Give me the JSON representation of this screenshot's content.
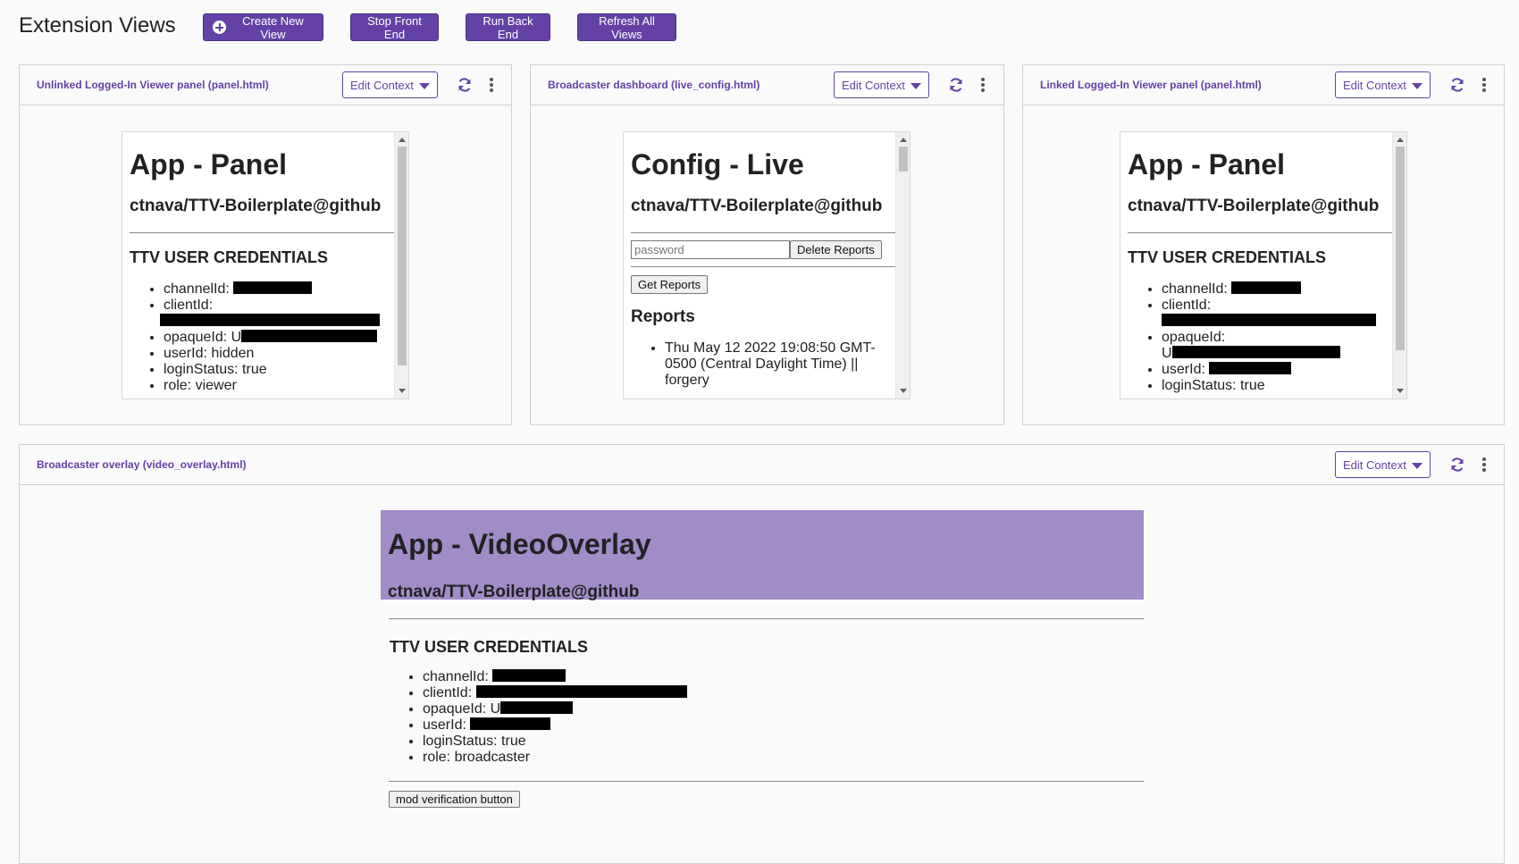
{
  "header": {
    "title": "Extension Views",
    "buttons": {
      "create_new_view": "Create New View",
      "stop_front_end": "Stop Front End",
      "run_back_end": "Run Back End",
      "refresh_all_views": "Refresh All Views"
    }
  },
  "colors": {
    "accent": "#6441a4",
    "overlay_bg": "#a18cc8"
  },
  "views": [
    {
      "title": "Unlinked Logged-In Viewer panel (panel.html)",
      "edit_context_label": "Edit Context",
      "content": {
        "heading": "App - Panel",
        "repo": "ctnava/TTV-Boilerplate@github",
        "creds_heading": "TTV USER CREDENTIALS",
        "channel_label": "channelId:",
        "client_label": "clientId:",
        "opaque_label": "opaqueId: U",
        "user_label": "userId: hidden",
        "login_label": "loginStatus: true",
        "role_label": "role: viewer"
      }
    },
    {
      "title": "Broadcaster dashboard (live_config.html)",
      "edit_context_label": "Edit Context",
      "content": {
        "heading": "Config - Live",
        "repo": "ctnava/TTV-Boilerplate@github",
        "password_placeholder": "password",
        "delete_reports_label": "Delete Reports",
        "get_reports_label": "Get Reports",
        "reports_heading": "Reports",
        "report_item": "Thu May 12 2022 19:08:50 GMT-0500 (Central Daylight Time) || forgery"
      }
    },
    {
      "title": "Linked Logged-In Viewer panel (panel.html)",
      "edit_context_label": "Edit Context",
      "content": {
        "heading": "App - Panel",
        "repo": "ctnava/TTV-Boilerplate@github",
        "creds_heading": "TTV USER CREDENTIALS",
        "channel_label": "channelId:",
        "client_label": "clientId:",
        "opaque_label": "opaqueId:",
        "opaque_prefix": "U",
        "user_label": "userId:",
        "login_label": "loginStatus: true"
      }
    },
    {
      "title": "Broadcaster overlay (video_overlay.html)",
      "edit_context_label": "Edit Context",
      "content": {
        "heading": "App - VideoOverlay",
        "repo": "ctnava/TTV-Boilerplate@github",
        "creds_heading": "TTV USER CREDENTIALS",
        "channel_label": "channelId:",
        "client_label": "clientId:",
        "opaque_label": "opaqueId: U",
        "user_label": "userId:",
        "login_label": "loginStatus: true",
        "role_label": "role: broadcaster",
        "mod_button_label": "mod verification button"
      }
    }
  ]
}
